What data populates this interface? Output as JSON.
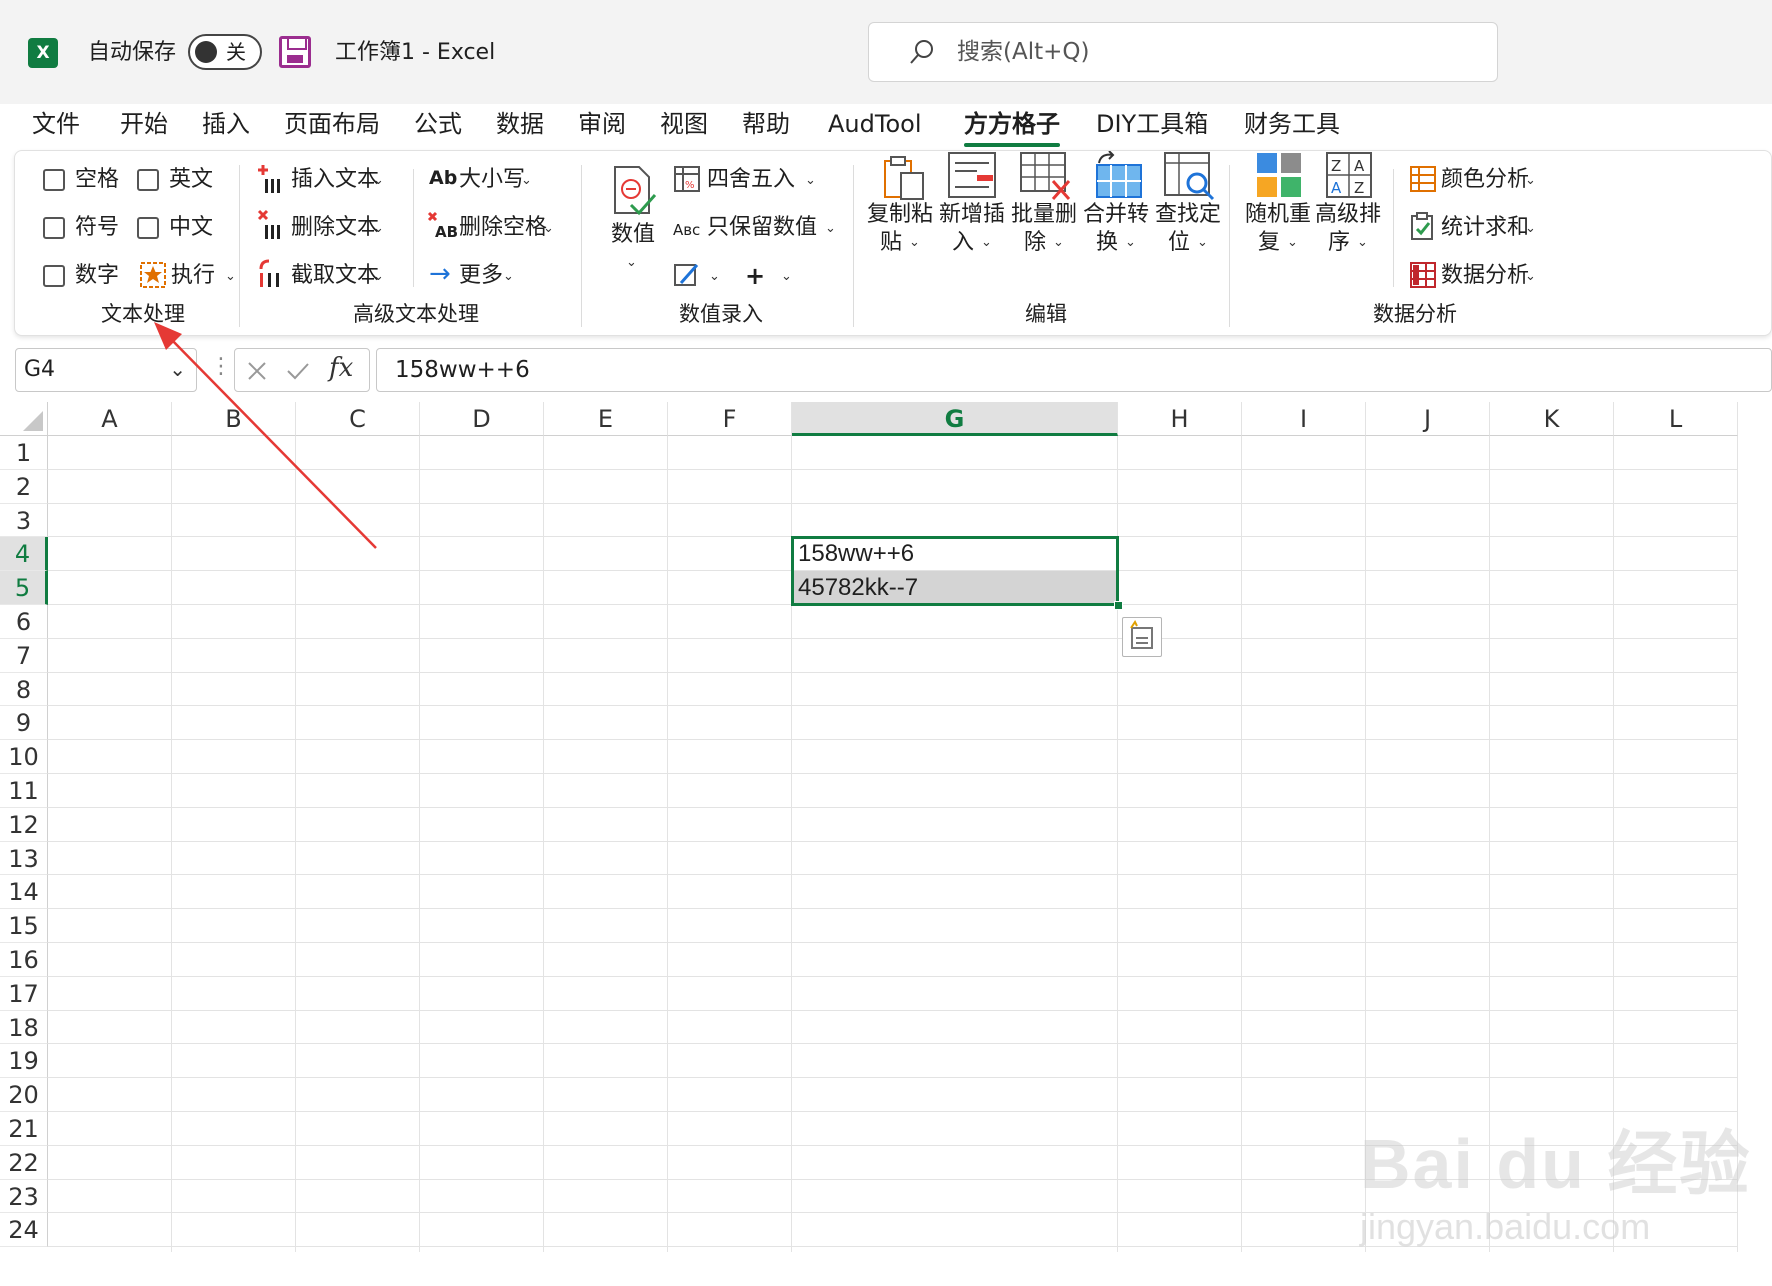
{
  "titlebar": {
    "app_letter": "X",
    "autosave_label": "自动保存",
    "toggle_state": "关",
    "doc_title": "工作簿1  -  Excel",
    "search_placeholder": "搜索(Alt+Q)"
  },
  "tabs": [
    "文件",
    "开始",
    "插入",
    "页面布局",
    "公式",
    "数据",
    "审阅",
    "视图",
    "帮助",
    "AudTool",
    "方方格子",
    "DIY工具箱",
    "财务工具"
  ],
  "active_tab": "方方格子",
  "ribbon": {
    "text_processing": {
      "checkboxes": [
        "空格",
        "英文",
        "符号",
        "中文",
        "数字"
      ],
      "execute": "执行",
      "label": "文本处理"
    },
    "advanced_text": {
      "items": [
        "插入文本",
        "删除文本",
        "截取文本",
        "大小写",
        "删除空格",
        "更多"
      ],
      "label": "高级文本处理"
    },
    "numeric_entry": {
      "big_button": "数值",
      "round": "四舍五入",
      "keep_values": "只保留数值",
      "label": "数值录入"
    },
    "edit": {
      "buttons": [
        {
          "line1": "复制粘",
          "line2": "贴"
        },
        {
          "line1": "新增插",
          "line2": "入"
        },
        {
          "line1": "批量删",
          "line2": "除"
        },
        {
          "line1": "合并转",
          "line2": "换"
        },
        {
          "line1": "查找定",
          "line2": "位"
        }
      ],
      "label": "编辑"
    },
    "data_analysis": {
      "buttons": [
        {
          "line1": "随机重",
          "line2": "复"
        },
        {
          "line1": "高级排",
          "line2": "序"
        }
      ],
      "items": [
        "颜色分析",
        "统计求和",
        "数据分析"
      ],
      "label": "数据分析"
    }
  },
  "formula_bar": {
    "name_box": "G4",
    "formula": "158ww++6"
  },
  "grid": {
    "columns": [
      "A",
      "B",
      "C",
      "D",
      "E",
      "F",
      "G",
      "H",
      "I",
      "J",
      "K",
      "L"
    ],
    "selected_column": "G",
    "rows": [
      "1",
      "2",
      "3",
      "4",
      "5",
      "6",
      "7",
      "8",
      "9",
      "10",
      "11",
      "12",
      "13",
      "14",
      "15",
      "16",
      "17",
      "18",
      "19",
      "20",
      "21",
      "22",
      "23",
      "24"
    ],
    "selected_rows": [
      "4",
      "5"
    ],
    "cells": {
      "G4": "158ww++6",
      "G5": "45782kk--7"
    }
  },
  "watermark": {
    "line1": "Bai du 经验",
    "line2": "jingyan.baidu.com"
  },
  "colors": {
    "excel_green": "#107c41",
    "annotation_red": "#e53935",
    "save_purple": "#9b2d8f"
  }
}
